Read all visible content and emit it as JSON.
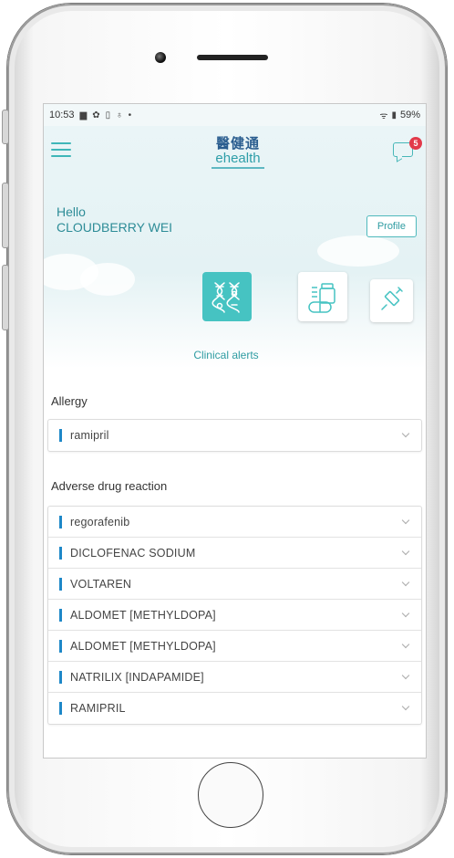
{
  "status_bar": {
    "time": "10:53",
    "battery": "59%"
  },
  "header": {
    "logo_zh": "醫健通",
    "logo_en": "ehealth",
    "message_badge": "5"
  },
  "greeting": {
    "hello": "Hello",
    "name": "CLOUDBERRY WEI",
    "profile_button": "Profile"
  },
  "tabs": {
    "active_label": "Clinical alerts",
    "icons": [
      "dna-icon",
      "medication-icon",
      "vaccine-icon"
    ]
  },
  "allergy": {
    "title": "Allergy",
    "items": [
      "ramipril"
    ]
  },
  "adverse_drug_reaction": {
    "title": "Adverse drug reaction",
    "items": [
      "regorafenib",
      "DICLOFENAC SODIUM",
      "VOLTAREN",
      "ALDOMET [METHYLDOPA]",
      "ALDOMET [METHYLDOPA]",
      "NATRILIX [INDAPAMIDE]",
      "RAMIPRIL"
    ]
  },
  "colors": {
    "accent": "#46c3c2",
    "marker": "#1e88c8",
    "badge": "#e23a4a"
  }
}
